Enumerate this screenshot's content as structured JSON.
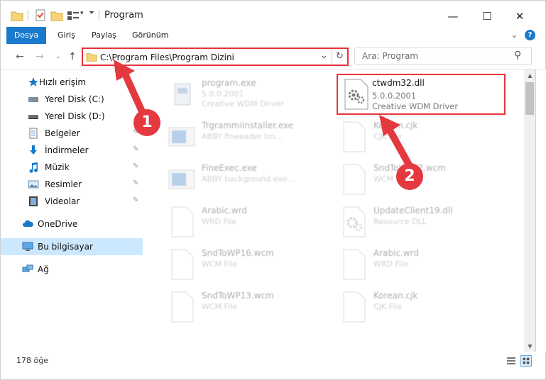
{
  "window": {
    "title": "Program",
    "minimize_glyph": "—",
    "maximize_glyph": "☐",
    "close_glyph": "✕"
  },
  "ribbon": {
    "tabs": [
      "Dosya",
      "Giriş",
      "Paylaş",
      "Görünüm"
    ],
    "expand_glyph": "⌄",
    "help_glyph": "?"
  },
  "navigation": {
    "back_glyph": "←",
    "forward_glyph": "→",
    "recent_glyph": "⌄",
    "up_glyph": "↑",
    "address_path": "C:\\Program Files\\Program Dizini",
    "address_dropdown_glyph": "⌄",
    "refresh_glyph": "↻",
    "search_placeholder": "Ara: Program",
    "search_glyph": "⚲"
  },
  "sidebar": {
    "items": [
      {
        "label": "Hızlı erişim",
        "icon": "star-icon"
      },
      {
        "label": "Yerel Disk (C:)",
        "icon": "drive-icon"
      },
      {
        "label": "Yerel Disk (D:)",
        "icon": "drive-icon"
      },
      {
        "label": "Belgeler",
        "icon": "documents-icon",
        "pinned": true
      },
      {
        "label": "İndirmeler",
        "icon": "download-icon",
        "pinned": true
      },
      {
        "label": "Müzik",
        "icon": "music-icon",
        "pinned": true
      },
      {
        "label": "Resimler",
        "icon": "pictures-icon",
        "pinned": true
      },
      {
        "label": "Videolar",
        "icon": "videos-icon",
        "pinned": true
      },
      {
        "label": "OneDrive",
        "icon": "cloud-icon"
      },
      {
        "label": "Bu bilgisayar",
        "icon": "computer-icon",
        "selected": true
      },
      {
        "label": "Ağ",
        "icon": "network-icon"
      }
    ],
    "pin_glyph": "📌"
  },
  "files": [
    {
      "name": "program.exe",
      "line1": "5.0.0.2001",
      "line2": "Creative WDM Driver",
      "icon": "exe-icon"
    },
    {
      "name": "ctwdm32.dll",
      "line1": "5.0.0.2001",
      "line2": "Creative WDM Driver",
      "icon": "dll-gear-icon",
      "highlighted": true
    },
    {
      "name": "Trgrammiinstaller.exe",
      "line1": "ABBY fineeader tm...",
      "icon": "window-icon"
    },
    {
      "name": "Korean.cjk",
      "line1": "CJK File",
      "icon": "blank-file-icon"
    },
    {
      "name": "FineExec.exe",
      "line1": "ABBY background exe...",
      "icon": "window-icon"
    },
    {
      "name": "SndToWP32.wcm",
      "line1": "WCM File",
      "icon": "blank-file-icon"
    },
    {
      "name": "Arabic.wrd",
      "line1": "WRD File",
      "icon": "blank-file-icon"
    },
    {
      "name": "UpdateClient19.dll",
      "line1": "Resource DLL",
      "icon": "dll-gear-icon"
    },
    {
      "name": "SndToWP16.wcm",
      "line1": "WCM File",
      "icon": "blank-file-icon"
    },
    {
      "name": "Arabic.wrd",
      "line1": "WRD File",
      "icon": "blank-file-icon"
    },
    {
      "name": "SndToWP13.wcm",
      "line1": "WCM File",
      "icon": "blank-file-icon"
    },
    {
      "name": "Korean.cjk",
      "line1": "CJK File",
      "icon": "blank-file-icon"
    }
  ],
  "status": {
    "item_count": "178 öğe"
  },
  "annotations": {
    "badge_1": "1",
    "badge_2": "2"
  },
  "colors": {
    "accent": "#1979ca",
    "highlight": "#e8323a",
    "selection": "#cce8ff"
  }
}
